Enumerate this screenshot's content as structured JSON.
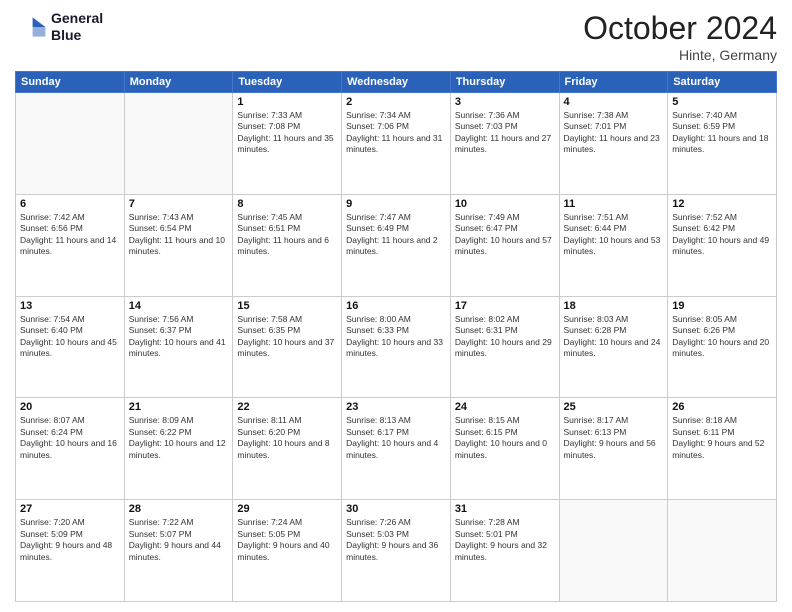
{
  "header": {
    "logo_line1": "General",
    "logo_line2": "Blue",
    "month": "October 2024",
    "location": "Hinte, Germany"
  },
  "weekdays": [
    "Sunday",
    "Monday",
    "Tuesday",
    "Wednesday",
    "Thursday",
    "Friday",
    "Saturday"
  ],
  "weeks": [
    [
      {
        "day": "",
        "text": ""
      },
      {
        "day": "",
        "text": ""
      },
      {
        "day": "1",
        "text": "Sunrise: 7:33 AM\nSunset: 7:08 PM\nDaylight: 11 hours and 35 minutes."
      },
      {
        "day": "2",
        "text": "Sunrise: 7:34 AM\nSunset: 7:06 PM\nDaylight: 11 hours and 31 minutes."
      },
      {
        "day": "3",
        "text": "Sunrise: 7:36 AM\nSunset: 7:03 PM\nDaylight: 11 hours and 27 minutes."
      },
      {
        "day": "4",
        "text": "Sunrise: 7:38 AM\nSunset: 7:01 PM\nDaylight: 11 hours and 23 minutes."
      },
      {
        "day": "5",
        "text": "Sunrise: 7:40 AM\nSunset: 6:59 PM\nDaylight: 11 hours and 18 minutes."
      }
    ],
    [
      {
        "day": "6",
        "text": "Sunrise: 7:42 AM\nSunset: 6:56 PM\nDaylight: 11 hours and 14 minutes."
      },
      {
        "day": "7",
        "text": "Sunrise: 7:43 AM\nSunset: 6:54 PM\nDaylight: 11 hours and 10 minutes."
      },
      {
        "day": "8",
        "text": "Sunrise: 7:45 AM\nSunset: 6:51 PM\nDaylight: 11 hours and 6 minutes."
      },
      {
        "day": "9",
        "text": "Sunrise: 7:47 AM\nSunset: 6:49 PM\nDaylight: 11 hours and 2 minutes."
      },
      {
        "day": "10",
        "text": "Sunrise: 7:49 AM\nSunset: 6:47 PM\nDaylight: 10 hours and 57 minutes."
      },
      {
        "day": "11",
        "text": "Sunrise: 7:51 AM\nSunset: 6:44 PM\nDaylight: 10 hours and 53 minutes."
      },
      {
        "day": "12",
        "text": "Sunrise: 7:52 AM\nSunset: 6:42 PM\nDaylight: 10 hours and 49 minutes."
      }
    ],
    [
      {
        "day": "13",
        "text": "Sunrise: 7:54 AM\nSunset: 6:40 PM\nDaylight: 10 hours and 45 minutes."
      },
      {
        "day": "14",
        "text": "Sunrise: 7:56 AM\nSunset: 6:37 PM\nDaylight: 10 hours and 41 minutes."
      },
      {
        "day": "15",
        "text": "Sunrise: 7:58 AM\nSunset: 6:35 PM\nDaylight: 10 hours and 37 minutes."
      },
      {
        "day": "16",
        "text": "Sunrise: 8:00 AM\nSunset: 6:33 PM\nDaylight: 10 hours and 33 minutes."
      },
      {
        "day": "17",
        "text": "Sunrise: 8:02 AM\nSunset: 6:31 PM\nDaylight: 10 hours and 29 minutes."
      },
      {
        "day": "18",
        "text": "Sunrise: 8:03 AM\nSunset: 6:28 PM\nDaylight: 10 hours and 24 minutes."
      },
      {
        "day": "19",
        "text": "Sunrise: 8:05 AM\nSunset: 6:26 PM\nDaylight: 10 hours and 20 minutes."
      }
    ],
    [
      {
        "day": "20",
        "text": "Sunrise: 8:07 AM\nSunset: 6:24 PM\nDaylight: 10 hours and 16 minutes."
      },
      {
        "day": "21",
        "text": "Sunrise: 8:09 AM\nSunset: 6:22 PM\nDaylight: 10 hours and 12 minutes."
      },
      {
        "day": "22",
        "text": "Sunrise: 8:11 AM\nSunset: 6:20 PM\nDaylight: 10 hours and 8 minutes."
      },
      {
        "day": "23",
        "text": "Sunrise: 8:13 AM\nSunset: 6:17 PM\nDaylight: 10 hours and 4 minutes."
      },
      {
        "day": "24",
        "text": "Sunrise: 8:15 AM\nSunset: 6:15 PM\nDaylight: 10 hours and 0 minutes."
      },
      {
        "day": "25",
        "text": "Sunrise: 8:17 AM\nSunset: 6:13 PM\nDaylight: 9 hours and 56 minutes."
      },
      {
        "day": "26",
        "text": "Sunrise: 8:18 AM\nSunset: 6:11 PM\nDaylight: 9 hours and 52 minutes."
      }
    ],
    [
      {
        "day": "27",
        "text": "Sunrise: 7:20 AM\nSunset: 5:09 PM\nDaylight: 9 hours and 48 minutes."
      },
      {
        "day": "28",
        "text": "Sunrise: 7:22 AM\nSunset: 5:07 PM\nDaylight: 9 hours and 44 minutes."
      },
      {
        "day": "29",
        "text": "Sunrise: 7:24 AM\nSunset: 5:05 PM\nDaylight: 9 hours and 40 minutes."
      },
      {
        "day": "30",
        "text": "Sunrise: 7:26 AM\nSunset: 5:03 PM\nDaylight: 9 hours and 36 minutes."
      },
      {
        "day": "31",
        "text": "Sunrise: 7:28 AM\nSunset: 5:01 PM\nDaylight: 9 hours and 32 minutes."
      },
      {
        "day": "",
        "text": ""
      },
      {
        "day": "",
        "text": ""
      }
    ]
  ]
}
